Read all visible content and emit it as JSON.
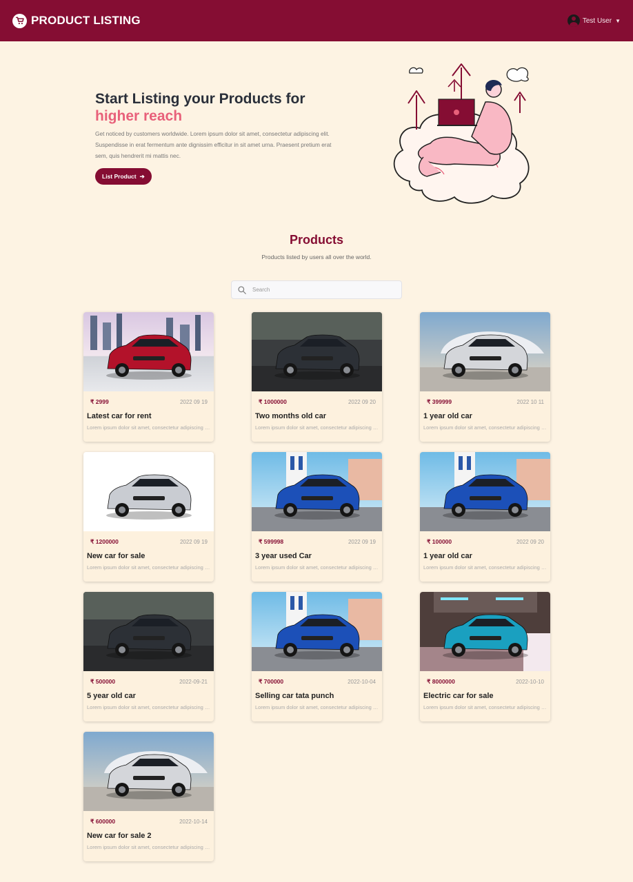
{
  "header": {
    "brand": "PRODUCT LISTING",
    "user_name": "Test User"
  },
  "hero": {
    "title": "Start Listing your Products for",
    "highlight": "higher reach",
    "description": "Get noticed by customers worldwide. Lorem ipsum dolor sit amet, consectetur adipiscing elit. Suspendisse in erat fermentum ante dignissim efficitur in sit amet urna. Praesent pretium erat sem, quis hendrerit mi mattis nec.",
    "button_label": "List Product"
  },
  "products_section": {
    "title": "Products",
    "subtitle": "Products listed by users all over the world.",
    "search_placeholder": "Search"
  },
  "products": [
    {
      "price": "₹ 2999",
      "date": "2022 09 19",
      "title": "Latest car for rent",
      "desc": "Lorem ipsum dolor sit amet, consectetur adipiscing elit.",
      "color": "#b3122a",
      "bg": "city"
    },
    {
      "price": "₹ 1000000",
      "date": "2022 09 20",
      "title": "Two months old car",
      "desc": "Lorem ipsum dolor sit amet, consectetur adipiscing elit.",
      "color": "#2c3036",
      "bg": "dark"
    },
    {
      "price": "₹ 399999",
      "date": "2022 10 11",
      "title": "1 year old car",
      "desc": "Lorem ipsum dolor sit amet, consectetur adipiscing elit.",
      "color": "#d4d6da",
      "bg": "dome"
    },
    {
      "price": "₹ 1200000",
      "date": "2022 09 19",
      "title": "New car for sale",
      "desc": "Lorem ipsum dolor sit amet, consectetur adipiscing elit.",
      "color": "#c9ccd2",
      "bg": "white"
    },
    {
      "price": "₹ 599998",
      "date": "2022 09 19",
      "title": "3 year used Car",
      "desc": "Lorem ipsum dolor sit amet, consectetur adipiscing elit.",
      "color": "#1c50b8",
      "bg": "street"
    },
    {
      "price": "₹ 100000",
      "date": "2022 09 20",
      "title": "1 year old car",
      "desc": "Lorem ipsum dolor sit amet, consectetur adipiscing elit.",
      "color": "#1c50b8",
      "bg": "street"
    },
    {
      "price": "₹ 500000",
      "date": "2022-09-21",
      "title": "5 year old car",
      "desc": "Lorem ipsum dolor sit amet, consectetur adipiscing elit.",
      "color": "#2c3036",
      "bg": "dark"
    },
    {
      "price": "₹ 700000",
      "date": "2022-10-04",
      "title": "Selling car tata punch",
      "desc": "Lorem ipsum dolor sit amet, consectetur adipiscing elit.",
      "color": "#1c50b8",
      "bg": "street"
    },
    {
      "price": "₹ 8000000",
      "date": "2022-10-10",
      "title": "Electric car for sale",
      "desc": "Lorem ipsum dolor sit amet, consectetur adipiscing elit.",
      "color": "#1aa0c0",
      "bg": "tunnel"
    },
    {
      "price": "₹ 600000",
      "date": "2022-10-14",
      "title": "New car for sale 2",
      "desc": "Lorem ipsum dolor sit amet, consectetur adipiscing elit.",
      "color": "#d4d6da",
      "bg": "dome"
    }
  ],
  "colors": {
    "brand": "#850d33",
    "accent": "#e8607a",
    "page_bg": "#fdf3e3"
  }
}
